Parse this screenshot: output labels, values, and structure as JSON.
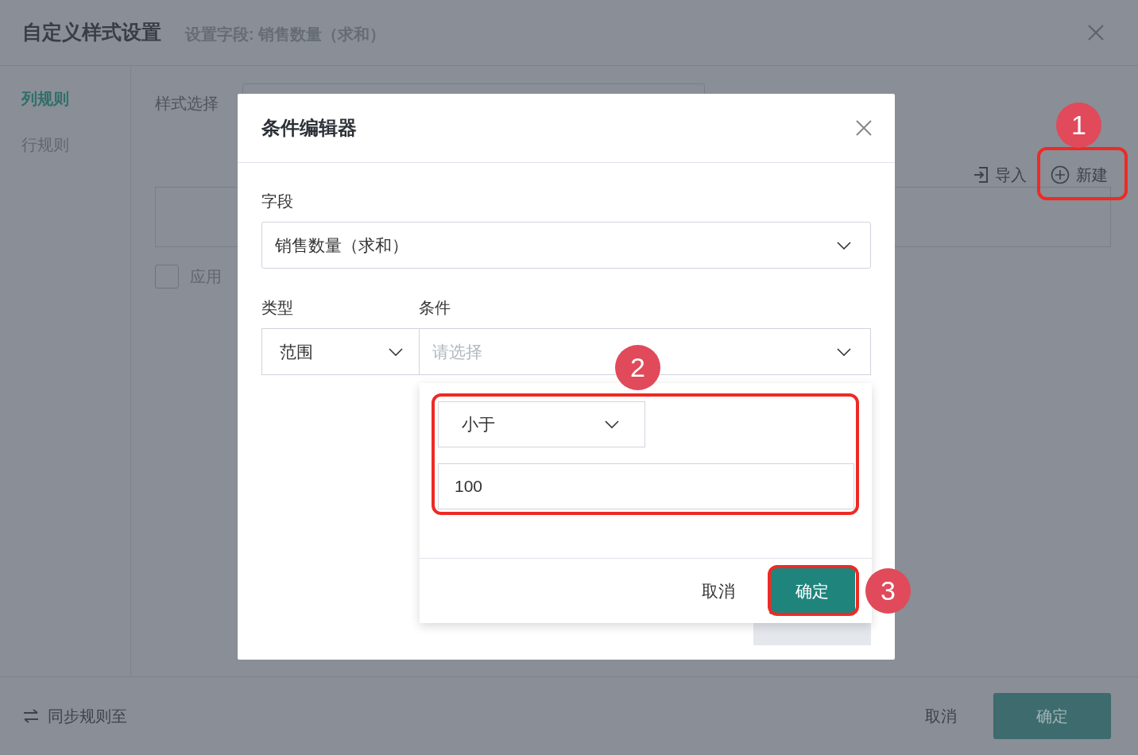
{
  "dialog": {
    "title": "自定义样式设置",
    "subtitle": "设置字段: 销售数量（求和）",
    "sidebar": [
      {
        "label": "列规则",
        "selected": true
      },
      {
        "label": "行规则",
        "selected": false
      }
    ],
    "style_label": "样式选择",
    "toolbar": [
      {
        "kind": "import",
        "label": "导入"
      },
      {
        "kind": "new",
        "label": "新建"
      }
    ],
    "apply_checkbox": {
      "label": "应用",
      "checked": false
    },
    "sync_link": "同步规则至",
    "buttons": [
      {
        "kind": "secondary",
        "label": "取消"
      },
      {
        "kind": "primary",
        "label": "确定"
      }
    ]
  },
  "condition_editor": {
    "title": "条件编辑器",
    "field_label": "字段",
    "field_value": "销售数量（求和）",
    "type_label": "类型",
    "type_value": "范围",
    "condition_label": "条件",
    "condition_placeholder": "请选择",
    "buttons": [
      {
        "kind": "disabled"
      }
    ]
  },
  "popover": {
    "operator": "小于",
    "value": "100",
    "buttons": [
      {
        "kind": "secondary",
        "label": "取消"
      },
      {
        "kind": "primary",
        "label": "确定"
      }
    ]
  },
  "annotations": [
    {
      "label": "1"
    },
    {
      "label": "2"
    },
    {
      "label": "3"
    }
  ]
}
